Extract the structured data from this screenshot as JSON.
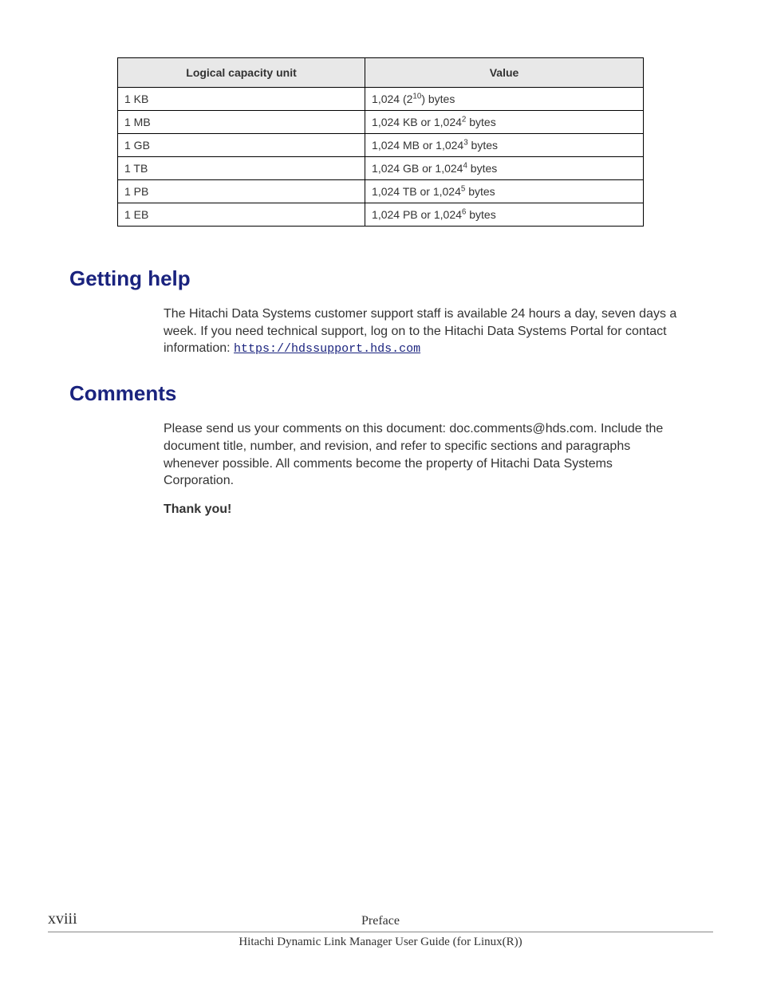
{
  "table": {
    "headers": {
      "col1": "Logical capacity unit",
      "col2": "Value"
    },
    "rows": [
      {
        "unit": "1 KB",
        "value_prefix": "1,024 (2",
        "value_sup": "10",
        "value_suffix": ") bytes"
      },
      {
        "unit": "1 MB",
        "value_prefix": "1,024 KB or 1,024",
        "value_sup": "2",
        "value_suffix": " bytes"
      },
      {
        "unit": "1 GB",
        "value_prefix": "1,024 MB or 1,024",
        "value_sup": "3",
        "value_suffix": " bytes"
      },
      {
        "unit": "1 TB",
        "value_prefix": "1,024 GB or 1,024",
        "value_sup": "4",
        "value_suffix": " bytes"
      },
      {
        "unit": "1 PB",
        "value_prefix": "1,024 TB or 1,024",
        "value_sup": "5",
        "value_suffix": " bytes"
      },
      {
        "unit": "1 EB",
        "value_prefix": "1,024 PB or 1,024",
        "value_sup": "6",
        "value_suffix": " bytes"
      }
    ]
  },
  "sections": {
    "getting_help": {
      "title": "Getting help",
      "text": "The Hitachi Data Systems customer support staff is available 24 hours a day, seven days a week. If you need technical support, log on to the Hitachi Data Systems Portal for contact information: ",
      "link": "https://hdssupport.hds.com"
    },
    "comments": {
      "title": "Comments",
      "text": "Please send us your comments on this document: doc.comments@hds.com. Include the document title, number, and revision, and refer to specific sections and paragraphs whenever possible. All comments become the property of Hitachi Data Systems Corporation.",
      "thank": "Thank you!"
    }
  },
  "footer": {
    "page": "xviii",
    "section": "Preface",
    "doc_title": "Hitachi Dynamic Link Manager User Guide (for Linux(R))"
  }
}
